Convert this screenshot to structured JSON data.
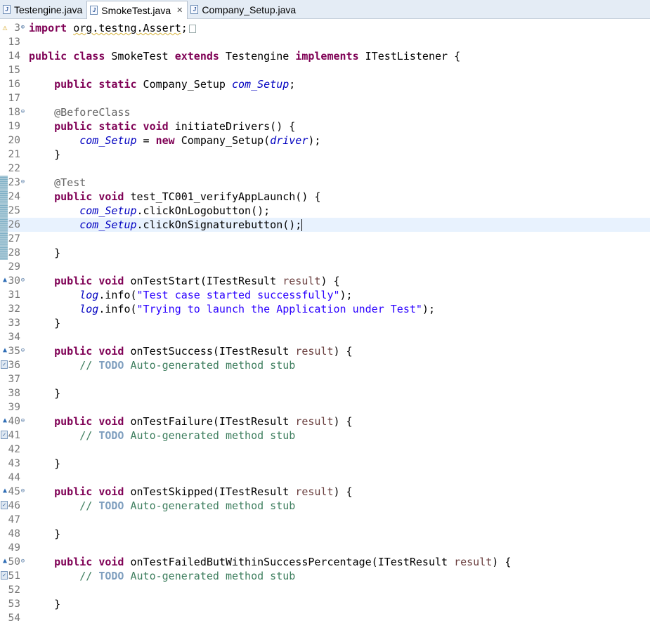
{
  "tabs": [
    {
      "label": "Testengine.java",
      "active": false
    },
    {
      "label": "SmokeTest.java",
      "active": true,
      "close": "✕"
    },
    {
      "label": "Company_Setup.java",
      "active": false
    }
  ],
  "lines": [
    {
      "num": "3",
      "fold": "+",
      "marker": "warn",
      "tokens": [
        [
          "kw",
          "import"
        ],
        [
          "plain",
          " "
        ],
        [
          "squig",
          "org.testng.Assert"
        ],
        [
          "plain",
          ";"
        ],
        [
          "elided",
          ""
        ]
      ]
    },
    {
      "num": "13",
      "tokens": []
    },
    {
      "num": "14",
      "tokens": [
        [
          "kw",
          "public class"
        ],
        [
          "plain",
          " SmokeTest "
        ],
        [
          "kw",
          "extends"
        ],
        [
          "plain",
          " Testengine "
        ],
        [
          "kw",
          "implements"
        ],
        [
          "plain",
          " ITestListener {"
        ]
      ]
    },
    {
      "num": "15",
      "tokens": []
    },
    {
      "num": "16",
      "tokens": [
        [
          "plain",
          "    "
        ],
        [
          "kw",
          "public static"
        ],
        [
          "plain",
          " Company_Setup "
        ],
        [
          "sfld",
          "com_Setup"
        ],
        [
          "plain",
          ";"
        ]
      ]
    },
    {
      "num": "17",
      "tokens": []
    },
    {
      "num": "18",
      "fold": "−",
      "tokens": [
        [
          "plain",
          "    "
        ],
        [
          "ann",
          "@BeforeClass"
        ]
      ]
    },
    {
      "num": "19",
      "tokens": [
        [
          "plain",
          "    "
        ],
        [
          "kw",
          "public static void"
        ],
        [
          "plain",
          " initiateDrivers() {"
        ]
      ]
    },
    {
      "num": "20",
      "tokens": [
        [
          "plain",
          "        "
        ],
        [
          "sfld",
          "com_Setup"
        ],
        [
          "plain",
          " = "
        ],
        [
          "kw",
          "new"
        ],
        [
          "plain",
          " Company_Setup("
        ],
        [
          "sfld",
          "driver"
        ],
        [
          "plain",
          ");"
        ]
      ]
    },
    {
      "num": "21",
      "tokens": [
        [
          "plain",
          "    }"
        ]
      ]
    },
    {
      "num": "22",
      "tokens": []
    },
    {
      "num": "23",
      "fold": "−",
      "change": true,
      "tokens": [
        [
          "plain",
          "    "
        ],
        [
          "ann",
          "@Test"
        ]
      ]
    },
    {
      "num": "24",
      "change": true,
      "tokens": [
        [
          "plain",
          "    "
        ],
        [
          "kw",
          "public void"
        ],
        [
          "plain",
          " test_TC001_verifyAppLaunch() {"
        ]
      ]
    },
    {
      "num": "25",
      "change": true,
      "tokens": [
        [
          "plain",
          "        "
        ],
        [
          "sfld",
          "com_Setup"
        ],
        [
          "plain",
          ".clickOnLogobutton();"
        ]
      ]
    },
    {
      "num": "26",
      "change": true,
      "current": true,
      "caret": true,
      "tokens": [
        [
          "plain",
          "        "
        ],
        [
          "sfld",
          "com_Setup"
        ],
        [
          "plain",
          ".clickOnSignaturebutton();"
        ]
      ]
    },
    {
      "num": "27",
      "change": true,
      "tokens": []
    },
    {
      "num": "28",
      "change": true,
      "tokens": [
        [
          "plain",
          "    }"
        ]
      ]
    },
    {
      "num": "29",
      "tokens": []
    },
    {
      "num": "30",
      "fold": "−",
      "marker": "override",
      "tokens": [
        [
          "plain",
          "    "
        ],
        [
          "kw",
          "public void"
        ],
        [
          "plain",
          " onTestStart(ITestResult "
        ],
        [
          "param",
          "result"
        ],
        [
          "plain",
          ") {"
        ]
      ]
    },
    {
      "num": "31",
      "tokens": [
        [
          "plain",
          "        "
        ],
        [
          "sfld",
          "log"
        ],
        [
          "plain",
          ".info("
        ],
        [
          "str",
          "\"Test case started successfully\""
        ],
        [
          "plain",
          ");"
        ]
      ]
    },
    {
      "num": "32",
      "tokens": [
        [
          "plain",
          "        "
        ],
        [
          "sfld",
          "log"
        ],
        [
          "plain",
          ".info("
        ],
        [
          "str",
          "\"Trying to launch the Application under Test\""
        ],
        [
          "plain",
          ");"
        ]
      ]
    },
    {
      "num": "33",
      "tokens": [
        [
          "plain",
          "    }"
        ]
      ]
    },
    {
      "num": "34",
      "tokens": []
    },
    {
      "num": "35",
      "fold": "−",
      "marker": "override",
      "tokens": [
        [
          "plain",
          "    "
        ],
        [
          "kw",
          "public void"
        ],
        [
          "plain",
          " onTestSuccess(ITestResult "
        ],
        [
          "param",
          "result"
        ],
        [
          "plain",
          ") {"
        ]
      ]
    },
    {
      "num": "36",
      "marker": "task",
      "tokens": [
        [
          "plain",
          "        "
        ],
        [
          "cmt",
          "// "
        ],
        [
          "todo",
          "TODO"
        ],
        [
          "cmt",
          " Auto-generated method stub"
        ]
      ]
    },
    {
      "num": "37",
      "tokens": []
    },
    {
      "num": "38",
      "tokens": [
        [
          "plain",
          "    }"
        ]
      ]
    },
    {
      "num": "39",
      "tokens": []
    },
    {
      "num": "40",
      "fold": "−",
      "marker": "override",
      "tokens": [
        [
          "plain",
          "    "
        ],
        [
          "kw",
          "public void"
        ],
        [
          "plain",
          " onTestFailure(ITestResult "
        ],
        [
          "param",
          "result"
        ],
        [
          "plain",
          ") {"
        ]
      ]
    },
    {
      "num": "41",
      "marker": "task",
      "tokens": [
        [
          "plain",
          "        "
        ],
        [
          "cmt",
          "// "
        ],
        [
          "todo",
          "TODO"
        ],
        [
          "cmt",
          " Auto-generated method stub"
        ]
      ]
    },
    {
      "num": "42",
      "tokens": []
    },
    {
      "num": "43",
      "tokens": [
        [
          "plain",
          "    }"
        ]
      ]
    },
    {
      "num": "44",
      "tokens": []
    },
    {
      "num": "45",
      "fold": "−",
      "marker": "override",
      "tokens": [
        [
          "plain",
          "    "
        ],
        [
          "kw",
          "public void"
        ],
        [
          "plain",
          " onTestSkipped(ITestResult "
        ],
        [
          "param",
          "result"
        ],
        [
          "plain",
          ") {"
        ]
      ]
    },
    {
      "num": "46",
      "marker": "task",
      "tokens": [
        [
          "plain",
          "        "
        ],
        [
          "cmt",
          "// "
        ],
        [
          "todo",
          "TODO"
        ],
        [
          "cmt",
          " Auto-generated method stub"
        ]
      ]
    },
    {
      "num": "47",
      "tokens": []
    },
    {
      "num": "48",
      "tokens": [
        [
          "plain",
          "    }"
        ]
      ]
    },
    {
      "num": "49",
      "tokens": []
    },
    {
      "num": "50",
      "fold": "−",
      "marker": "override",
      "tokens": [
        [
          "plain",
          "    "
        ],
        [
          "kw",
          "public void"
        ],
        [
          "plain",
          " onTestFailedButWithinSuccessPercentage(ITestResult "
        ],
        [
          "param",
          "result"
        ],
        [
          "plain",
          ") {"
        ]
      ]
    },
    {
      "num": "51",
      "marker": "task",
      "tokens": [
        [
          "plain",
          "        "
        ],
        [
          "cmt",
          "// "
        ],
        [
          "todo",
          "TODO"
        ],
        [
          "cmt",
          " Auto-generated method stub"
        ]
      ]
    },
    {
      "num": "52",
      "tokens": []
    },
    {
      "num": "53",
      "tokens": [
        [
          "plain",
          "    }"
        ]
      ]
    },
    {
      "num": "54",
      "tokens": []
    }
  ],
  "icons": {
    "java_file": "J",
    "override": "▲",
    "task": "✓",
    "warn": "⚠"
  }
}
